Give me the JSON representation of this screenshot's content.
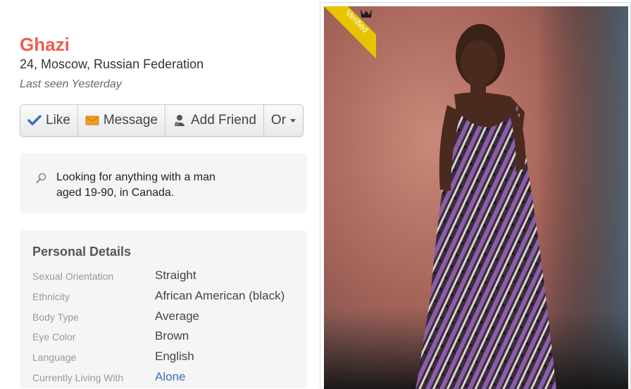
{
  "profile": {
    "name": "Ghazi",
    "subline": "24, Moscow, Russian Federation",
    "last_seen": "Last seen Yesterday"
  },
  "actions": {
    "like": "Like",
    "message": "Message",
    "add_friend": "Add Friend",
    "or": "Or"
  },
  "looking_for": {
    "line1": "Looking for anything with a man",
    "line2": "aged 19-90, in Canada."
  },
  "personal_details": {
    "title": "Personal Details",
    "rows": [
      {
        "label": "Sexual Orientation",
        "value": "Straight"
      },
      {
        "label": "Ethnicity",
        "value": "African American (black)"
      },
      {
        "label": "Body Type",
        "value": "Average"
      },
      {
        "label": "Eye Color",
        "value": "Brown"
      },
      {
        "label": "Language",
        "value": "English"
      },
      {
        "label": "Currently Living With",
        "value": "Alone"
      }
    ]
  },
  "photo": {
    "verified_label": "Verified"
  },
  "colors": {
    "name": "#e8604c",
    "link": "#3a6fc4",
    "ribbon": "#e8c400"
  }
}
